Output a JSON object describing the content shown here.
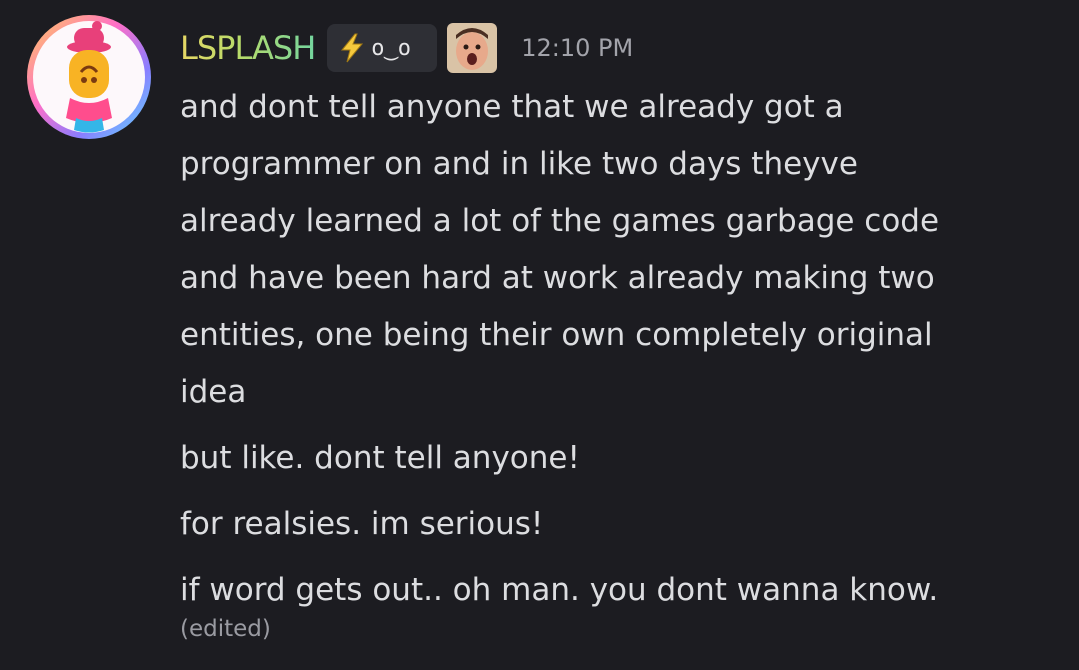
{
  "message": {
    "username": "LSPLASH",
    "tag": {
      "icon": "lightning-icon",
      "text": "o‿o"
    },
    "role_icon": "face-emoji-icon",
    "timestamp": "12:10 PM",
    "lines": [
      "and dont tell anyone that we already got a",
      "programmer on and in like two days theyve",
      "already learned a lot of the games garbage code",
      "and have been hard at work already making two",
      "entities, one being their own completely original",
      "idea",
      "but like. dont tell anyone!",
      "for realsies. im serious!",
      "if word gets out.. oh man. you dont wanna know."
    ],
    "edited_label": "(edited)"
  },
  "colors": {
    "background": "#1c1c21",
    "text": "#dcdde0",
    "muted": "#a2a3aa",
    "username_gradient": [
      "#e7d765",
      "#74d59f"
    ]
  }
}
